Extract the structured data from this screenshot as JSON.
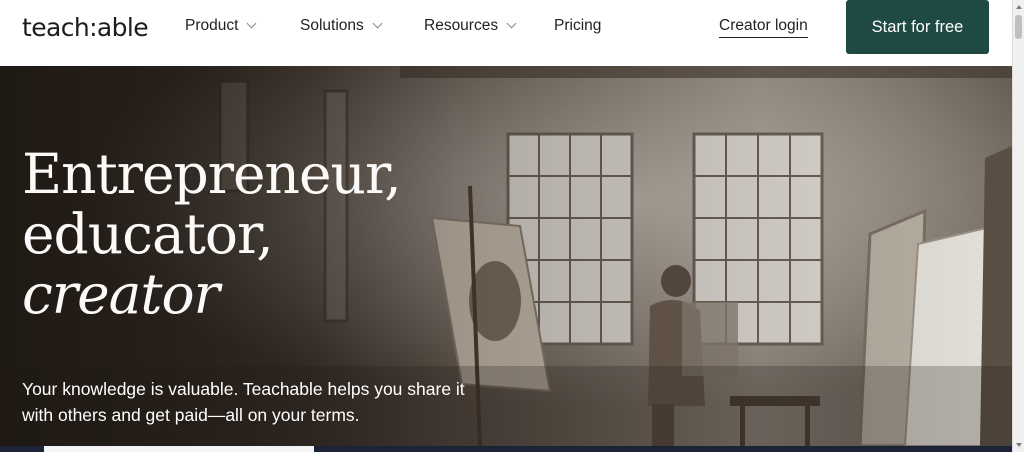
{
  "brand": {
    "logo_text": "teach:able"
  },
  "nav": {
    "items": [
      {
        "label": "Product",
        "has_dropdown": true
      },
      {
        "label": "Solutions",
        "has_dropdown": true
      },
      {
        "label": "Resources",
        "has_dropdown": true
      },
      {
        "label": "Pricing",
        "has_dropdown": false
      }
    ],
    "login_label": "Creator login",
    "cta_label": "Start for free"
  },
  "hero": {
    "headline_line1": "Entrepreneur,",
    "headline_line2": "educator,",
    "headline_line3": "creator",
    "subtext": "Your knowledge is valuable. Teachable helps you share it with others and get paid—all on your terms."
  },
  "colors": {
    "cta_background": "#1f4a44",
    "hero_text": "#ffffff",
    "nav_text": "#222222"
  }
}
